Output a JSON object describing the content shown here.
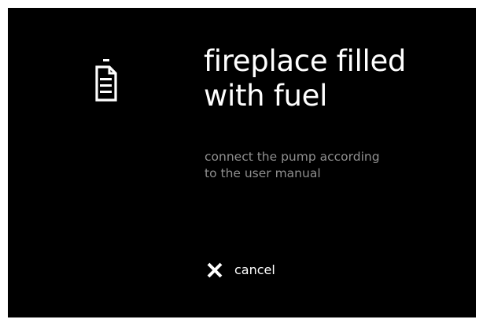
{
  "dialog": {
    "icon": "fuel-document-icon",
    "title": "fireplace filled\nwith fuel",
    "message": "connect the pump according\nto the user manual"
  },
  "actions": {
    "cancel_icon": "close-icon",
    "cancel_label": "cancel"
  },
  "colors": {
    "background": "#000000",
    "text_primary": "#ffffff",
    "text_secondary": "#8f8f8f"
  }
}
